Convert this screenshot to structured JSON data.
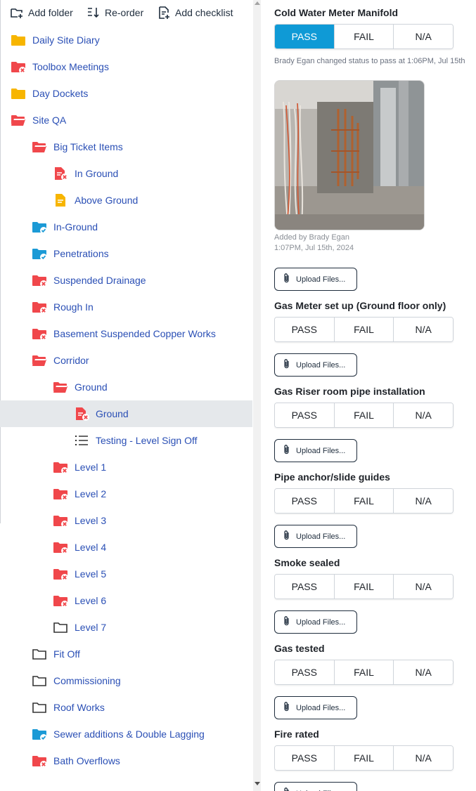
{
  "toolbar": {
    "add_folder": "Add folder",
    "reorder": "Re-order",
    "add_checklist": "Add checklist"
  },
  "tree": [
    {
      "label": "Daily Site Diary",
      "icon": "folder-yellow",
      "depth": 0
    },
    {
      "label": "Toolbox Meetings",
      "icon": "folder-red-x",
      "depth": 0
    },
    {
      "label": "Day Dockets",
      "icon": "folder-yellow",
      "depth": 0
    },
    {
      "label": "Site QA",
      "icon": "folder-open-red",
      "depth": 0
    },
    {
      "label": "Big Ticket Items",
      "icon": "folder-open-red",
      "depth": 1
    },
    {
      "label": "In Ground",
      "icon": "doc-red-x",
      "depth": 2
    },
    {
      "label": "Above Ground",
      "icon": "doc-yellow",
      "depth": 2
    },
    {
      "label": "In-Ground",
      "icon": "folder-blue-check",
      "depth": 1
    },
    {
      "label": "Penetrations",
      "icon": "folder-blue-check",
      "depth": 1
    },
    {
      "label": "Suspended Drainage",
      "icon": "folder-red-x",
      "depth": 1
    },
    {
      "label": "Rough In",
      "icon": "folder-red-x",
      "depth": 1
    },
    {
      "label": "Basement Suspended Copper Works",
      "icon": "folder-red-x",
      "depth": 1
    },
    {
      "label": "Corridor",
      "icon": "folder-open-red",
      "depth": 1
    },
    {
      "label": "Ground",
      "icon": "folder-open-red",
      "depth": 2
    },
    {
      "label": "Ground",
      "icon": "doc-red-x",
      "depth": 3,
      "selected": true
    },
    {
      "label": "Testing - Level Sign Off",
      "icon": "list",
      "depth": 3
    },
    {
      "label": "Level 1",
      "icon": "folder-red-x",
      "depth": 2
    },
    {
      "label": "Level 2",
      "icon": "folder-red-x",
      "depth": 2
    },
    {
      "label": "Level 3",
      "icon": "folder-red-x",
      "depth": 2
    },
    {
      "label": "Level 4",
      "icon": "folder-red-x",
      "depth": 2
    },
    {
      "label": "Level 5",
      "icon": "folder-red-x",
      "depth": 2
    },
    {
      "label": "Level 6",
      "icon": "folder-red-x",
      "depth": 2
    },
    {
      "label": "Level 7",
      "icon": "folder-outline",
      "depth": 2
    },
    {
      "label": "Fit Off",
      "icon": "folder-outline",
      "depth": 1
    },
    {
      "label": "Commissioning",
      "icon": "folder-outline",
      "depth": 1
    },
    {
      "label": "Roof Works",
      "icon": "folder-outline",
      "depth": 1
    },
    {
      "label": "Sewer additions & Double Lagging",
      "icon": "folder-blue-check",
      "depth": 1
    },
    {
      "label": "Bath Overflows",
      "icon": "folder-red-x",
      "depth": 1
    }
  ],
  "checklist": {
    "options": {
      "pass": "PASS",
      "fail": "FAIL",
      "na": "N/A"
    },
    "upload_label": "Upload Files...",
    "items": [
      {
        "title": "Cold Water Meter Manifold",
        "status": "pass",
        "status_note": "Brady Egan changed status to pass at 1:06PM, Jul 15th",
        "photo": {
          "added_by": "Added by Brady Egan",
          "added_at": "1:07PM, Jul 15th, 2024"
        }
      },
      {
        "title": "Gas Meter set up (Ground floor only)",
        "status": ""
      },
      {
        "title": "Gas Riser room pipe installation",
        "status": ""
      },
      {
        "title": "Pipe anchor/slide guides",
        "status": ""
      },
      {
        "title": "Smoke sealed",
        "status": ""
      },
      {
        "title": "Gas tested",
        "status": ""
      },
      {
        "title": "Fire rated",
        "status": ""
      }
    ]
  },
  "colors": {
    "link": "#2a4fb5",
    "pass_active": "#0f9ad6",
    "folder_yellow": "#f7b500",
    "folder_red": "#f0474b",
    "folder_blue": "#1b9ad6",
    "selected_row": "#e5e8eb"
  }
}
